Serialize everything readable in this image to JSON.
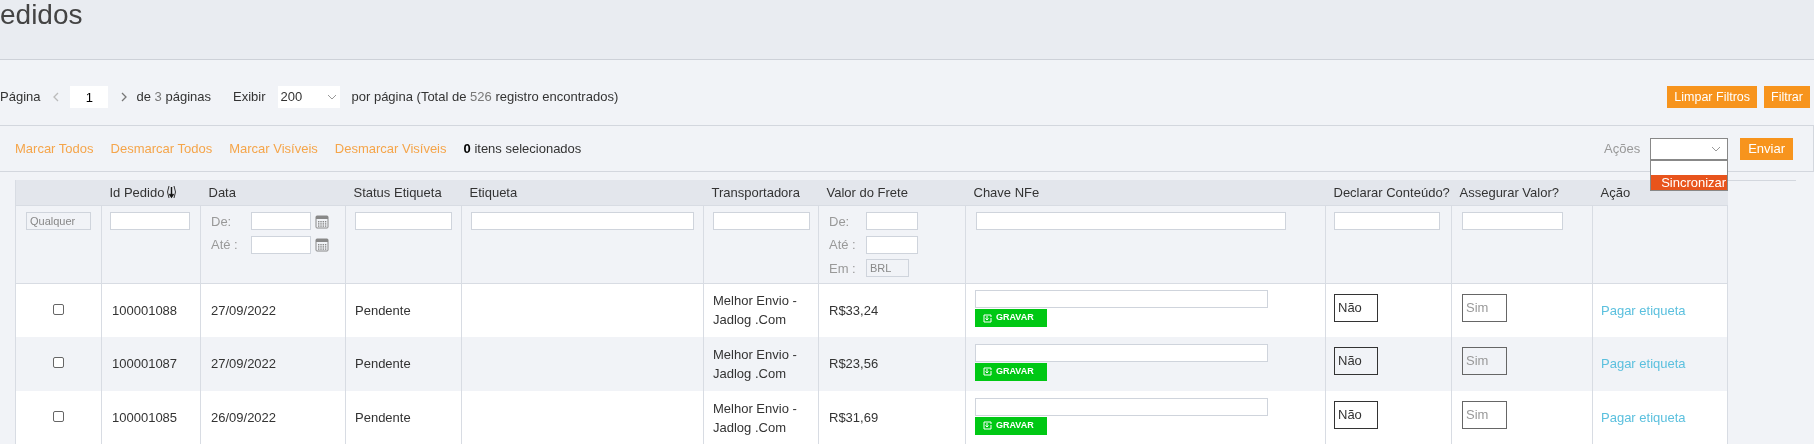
{
  "page_title": "edidos",
  "pagination": {
    "page_label": "Página",
    "page_value": "1",
    "of_label": "de",
    "page_count": "3",
    "pages_label": "páginas",
    "show_label": "Exibir",
    "per_page": "200",
    "total_before": "por página (Total de",
    "total_count": "526",
    "total_after": "registro encontrados)"
  },
  "filter_buttons": [
    "Limpar Filtros",
    "Filtrar"
  ],
  "bulk_links": [
    "Marcar Todos",
    "Desmarcar Todos",
    "Marcar Visíveis",
    "Desmarcar Visíveis"
  ],
  "selected_count": "0",
  "selected_label": "itens selecionados",
  "actions": {
    "label": "Ações",
    "open": true,
    "options": [
      {
        "label": "Sincronizar",
        "selected": true
      }
    ],
    "submit": "Enviar"
  },
  "columns": [
    {
      "label": "Id Pedido",
      "sorted": true
    },
    {
      "label": "Data",
      "sorted": false
    },
    {
      "label": "Status Etiqueta",
      "sorted": false
    },
    {
      "label": "Etiqueta",
      "sorted": false
    },
    {
      "label": "Transportadora",
      "sorted": false
    },
    {
      "label": "Valor do Frete",
      "sorted": false
    },
    {
      "label": "Chave NFe",
      "sorted": false
    },
    {
      "label": "Declarar Conteúdo?",
      "sorted": false
    },
    {
      "label": "Assegurar Valor?",
      "sorted": false
    },
    {
      "label": "Ação",
      "sorted": false
    }
  ],
  "filters": {
    "select_placeholder": "Qualquer",
    "date_from": "De:",
    "date_to": "Até :",
    "value_from": "De:",
    "value_to": "Até :",
    "currency_label": "Em :",
    "currency": "BRL"
  },
  "rows": [
    {
      "checked": false,
      "id": "100001088",
      "date": "27/09/2022",
      "status": "Pendente",
      "carrier": "Melhor Envio - Jadlog .Com",
      "freight": "R$33,24",
      "save_label": "GRAVAR",
      "declare": "Não",
      "insure": "Sim",
      "action": "Pagar etiqueta"
    },
    {
      "checked": false,
      "id": "100001087",
      "date": "27/09/2022",
      "status": "Pendente",
      "carrier": "Melhor Envio - Jadlog .Com",
      "freight": "R$23,56",
      "save_label": "GRAVAR",
      "declare": "Não",
      "insure": "Sim",
      "action": "Pagar etiqueta"
    },
    {
      "checked": false,
      "id": "100001085",
      "date": "26/09/2022",
      "status": "Pendente",
      "carrier": "Melhor Envio - Jadlog .Com",
      "freight": "R$31,69",
      "save_label": "GRAVAR",
      "declare": "Não",
      "insure": "Sim",
      "action": "Pagar etiqueta"
    }
  ]
}
